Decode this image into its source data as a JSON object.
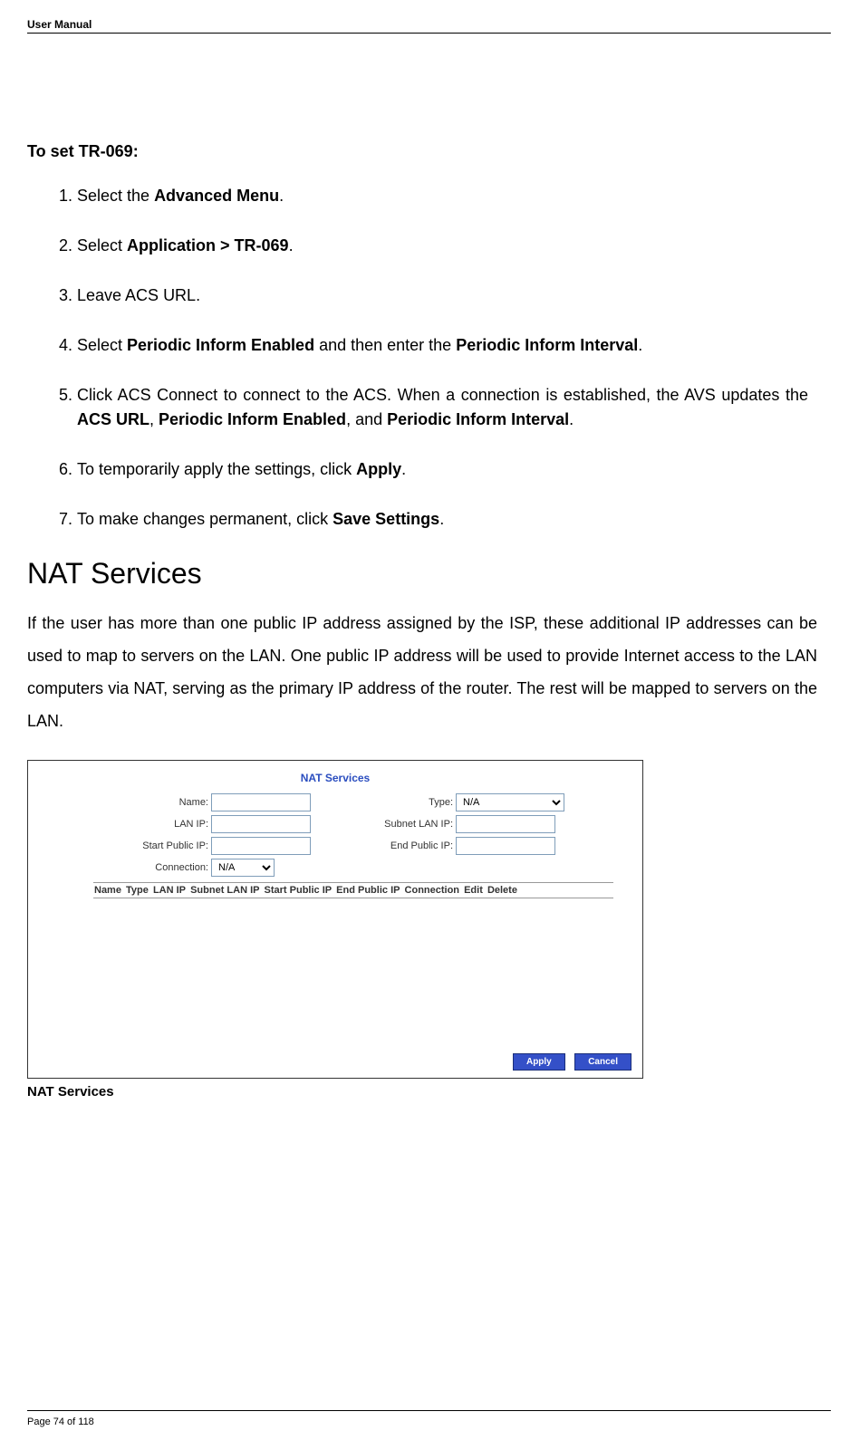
{
  "header": {
    "label": "User Manual"
  },
  "procedure": {
    "title": "To set TR-069:",
    "steps": [
      {
        "prefix": "Select the ",
        "bold1": "Advanced Menu",
        "suffix": "."
      },
      {
        "prefix": "Select ",
        "bold1": "Application > TR-069",
        "suffix": "."
      },
      {
        "prefix": "Leave ACS URL."
      },
      {
        "prefix": "Select ",
        "bold1": "Periodic Inform Enabled",
        "mid1": " and then enter the ",
        "bold2": "Periodic Inform Interval",
        "suffix": "."
      },
      {
        "prefix": "Click ACS Connect to connect to the ACS. When a connection is established, the AVS updates the ",
        "bold1": "ACS URL",
        "mid1": ", ",
        "bold2": "Periodic Inform Enabled",
        "mid2": ", and ",
        "bold3": "Periodic Inform Interval",
        "suffix": "."
      },
      {
        "prefix": "To temporarily apply the settings, click ",
        "bold1": "Apply",
        "suffix": "."
      },
      {
        "prefix": "To make changes permanent, click ",
        "bold1": "Save Settings",
        "suffix": "."
      }
    ]
  },
  "section": {
    "heading": "NAT Services",
    "para": "If the user has more than one public IP address assigned by the ISP, these additional IP addresses can be used to map to servers on the LAN. One public IP address will be used to provide Internet access to the LAN computers via NAT, serving as the primary IP address of the router. The rest will be mapped to servers on the LAN."
  },
  "screenshot": {
    "title": "NAT Services",
    "labels": {
      "name": "Name:",
      "type": "Type:",
      "lan_ip": "LAN IP:",
      "subnet_lan_ip": "Subnet LAN IP:",
      "start_public_ip": "Start Public IP:",
      "end_public_ip": "End Public IP:",
      "connection": "Connection:"
    },
    "select_values": {
      "type": "N/A",
      "connection": "N/A"
    },
    "table_headers": [
      "Name",
      "Type",
      "LAN IP",
      "Subnet LAN IP",
      "Start Public IP",
      "End Public IP",
      "Connection",
      "Edit",
      "Delete"
    ],
    "buttons": {
      "apply": "Apply",
      "cancel": "Cancel"
    }
  },
  "figure_caption": "NAT Services",
  "footer": {
    "page": "Page 74 of 118"
  }
}
